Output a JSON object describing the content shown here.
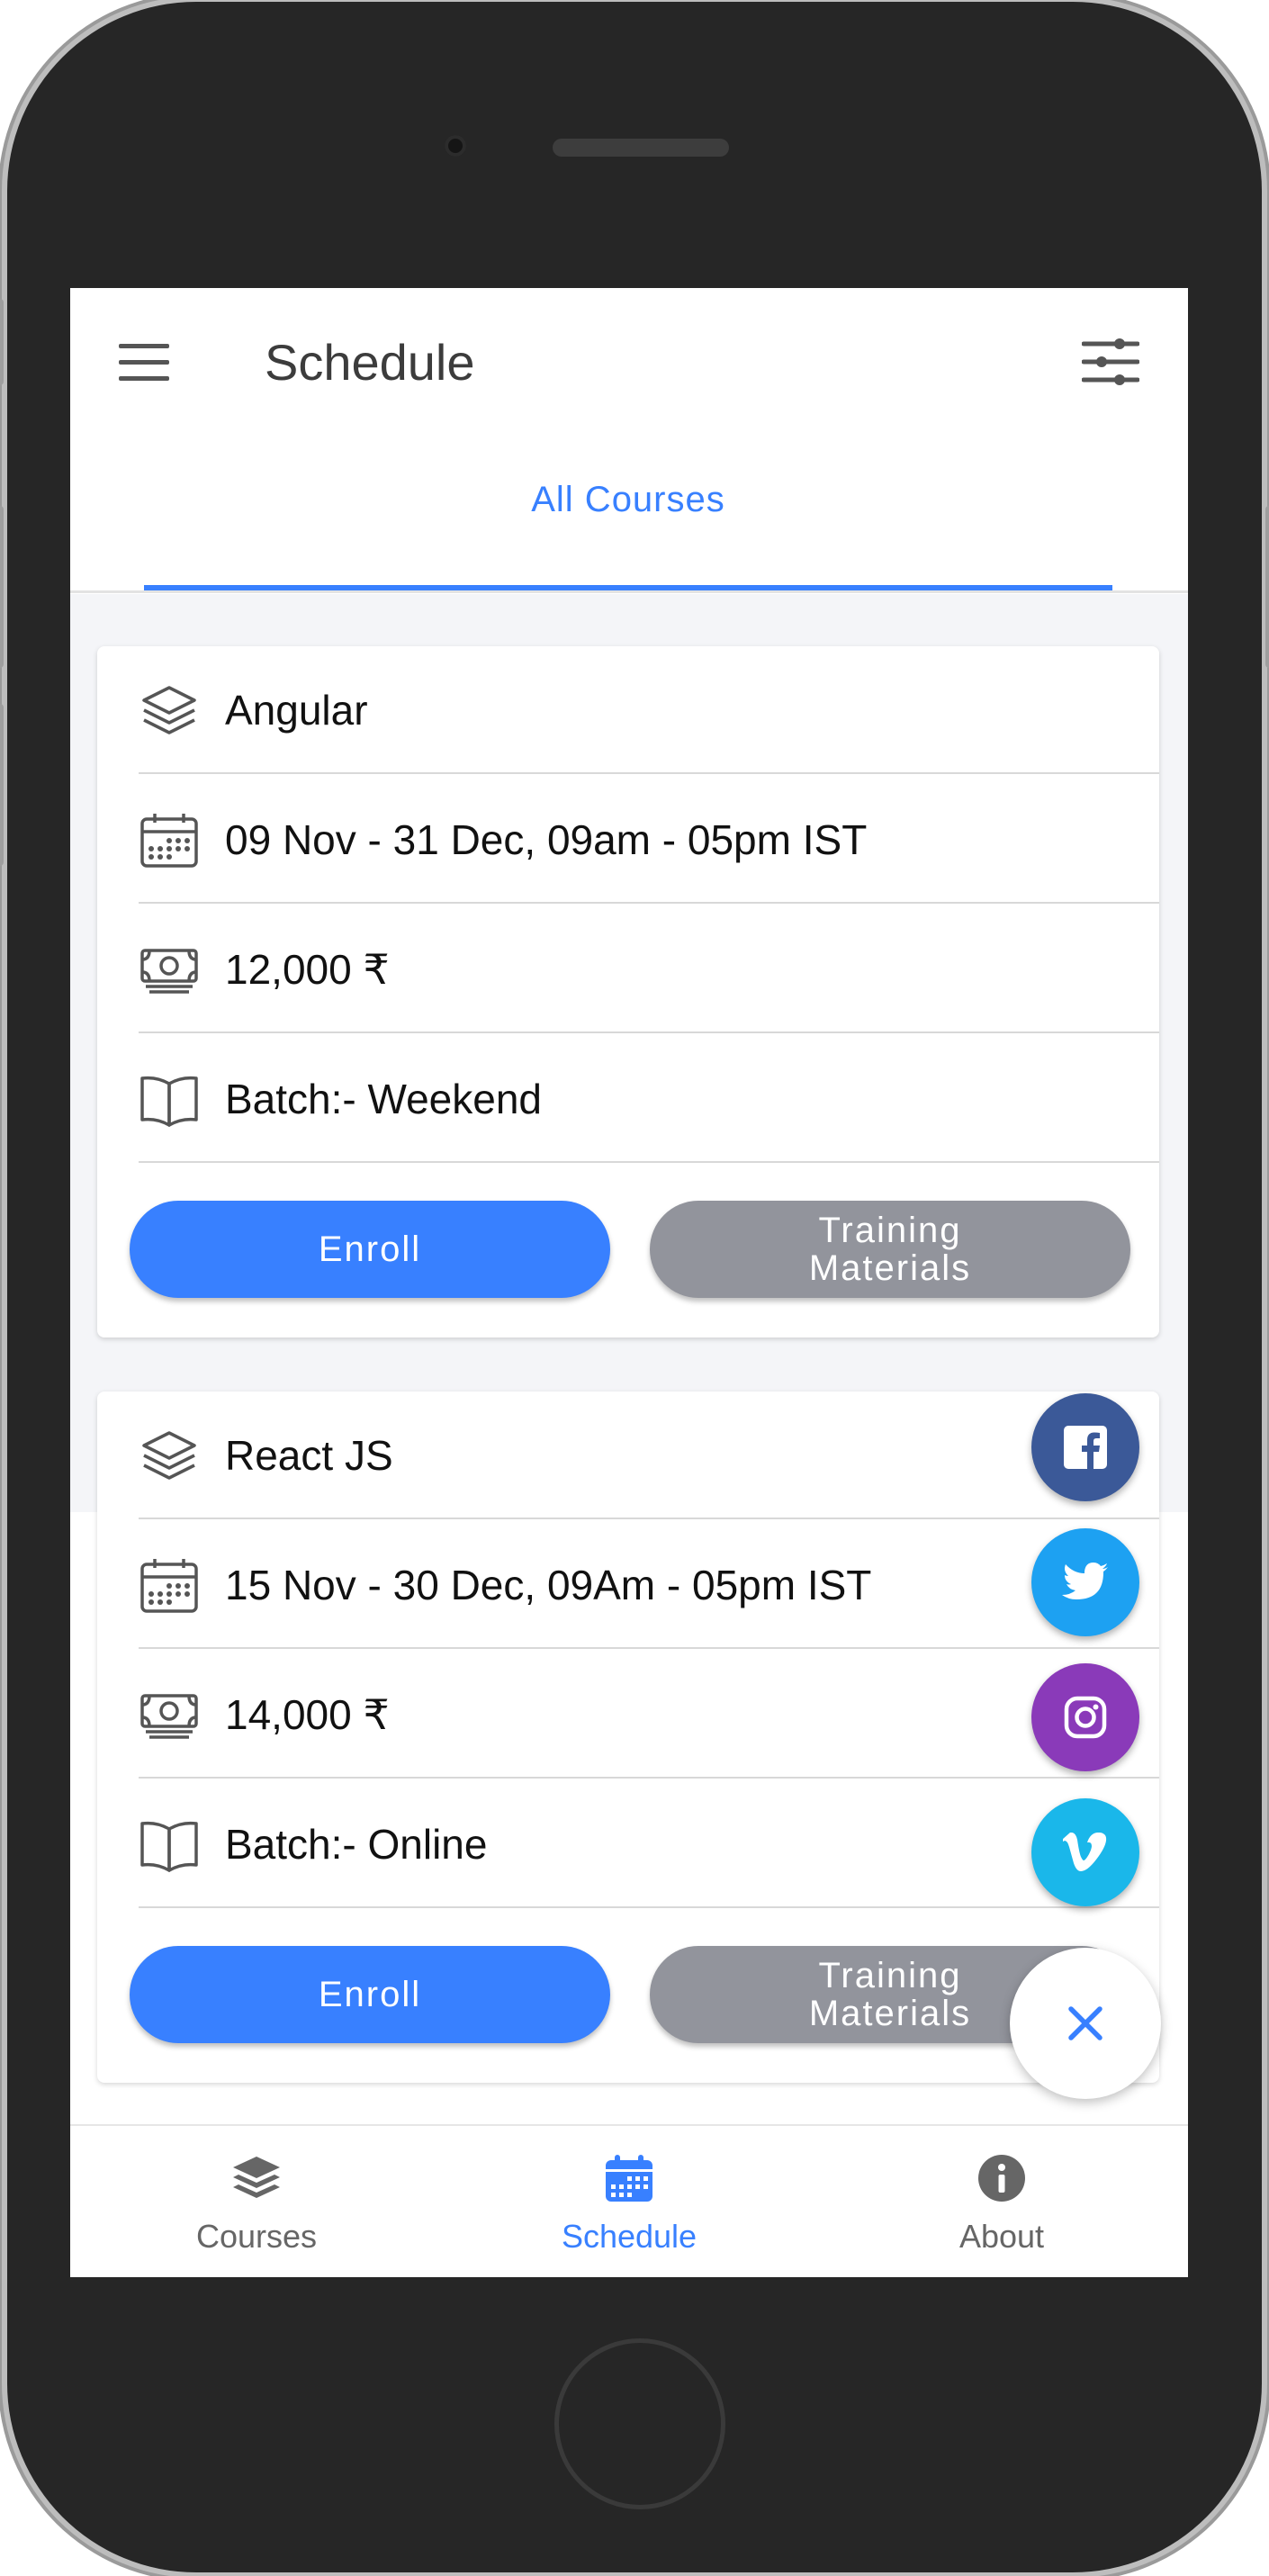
{
  "header": {
    "title": "Schedule",
    "menu_icon": "hamburger-menu-icon",
    "filter_icon": "sliders-filter-icon"
  },
  "tabs": [
    {
      "label": "All Courses",
      "selected": true
    }
  ],
  "courses": [
    {
      "name": "Angular",
      "schedule": "09 Nov - 31 Dec, 09am - 05pm IST",
      "price": "12,000 ₹",
      "batch": "Batch:- Weekend",
      "enroll_label": "Enroll",
      "materials_label": "Training\nMaterials"
    },
    {
      "name": "React JS",
      "schedule": "15 Nov - 30 Dec, 09Am - 05pm IST",
      "price": "14,000 ₹",
      "batch": "Batch:- Online",
      "enroll_label": "Enroll",
      "materials_label": "Training\nMaterials"
    }
  ],
  "social_fab": {
    "items": [
      {
        "name": "facebook",
        "icon": "facebook-icon",
        "color": "#3b5998"
      },
      {
        "name": "twitter",
        "icon": "twitter-icon",
        "color": "#1da1f2"
      },
      {
        "name": "instagram",
        "icon": "instagram-icon",
        "color": "#8a3ab9"
      },
      {
        "name": "vimeo",
        "icon": "vimeo-icon",
        "color": "#1ab7ea"
      }
    ],
    "close_icon": "close-icon"
  },
  "bottom_nav": [
    {
      "label": "Courses",
      "icon": "layers-icon",
      "active": false
    },
    {
      "label": "Schedule",
      "icon": "calendar-icon",
      "active": true
    },
    {
      "label": "About",
      "icon": "info-icon",
      "active": false
    }
  ],
  "colors": {
    "primary": "#3880ff",
    "medium": "#92949c",
    "text": "#111111"
  }
}
